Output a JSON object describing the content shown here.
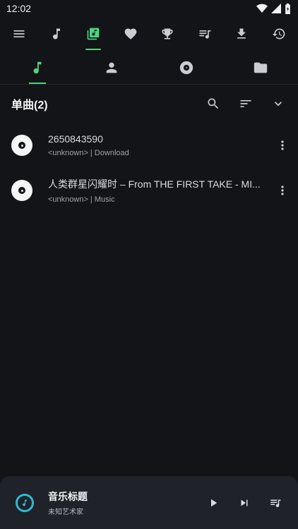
{
  "status_bar": {
    "time": "12:02"
  },
  "top_toolbar": {
    "items": [
      {
        "icon": "menu-icon"
      },
      {
        "icon": "music-note-icon"
      },
      {
        "icon": "music-library-icon",
        "active": true
      },
      {
        "icon": "heart-icon"
      },
      {
        "icon": "trophy-icon"
      },
      {
        "icon": "queue-music-icon"
      },
      {
        "icon": "download-icon"
      },
      {
        "icon": "history-icon"
      }
    ]
  },
  "sub_tabs": [
    {
      "icon": "song-icon",
      "active": true
    },
    {
      "icon": "artist-icon"
    },
    {
      "icon": "album-disc-icon"
    },
    {
      "icon": "folder-icon"
    }
  ],
  "list": {
    "title": "单曲(2)",
    "songs": [
      {
        "title": "2650843590",
        "subtitle": "<unknown> | Download"
      },
      {
        "title": "人类群星闪耀时 – From THE FIRST TAKE - MI...",
        "subtitle": "<unknown> | Music"
      }
    ]
  },
  "mini_player": {
    "title": "音乐标题",
    "artist": "未知艺术家"
  },
  "colors": {
    "accent": "#4cd480",
    "background": "#131417",
    "player_bg": "#1f2228",
    "cover_ring": "#2fb9d6"
  }
}
